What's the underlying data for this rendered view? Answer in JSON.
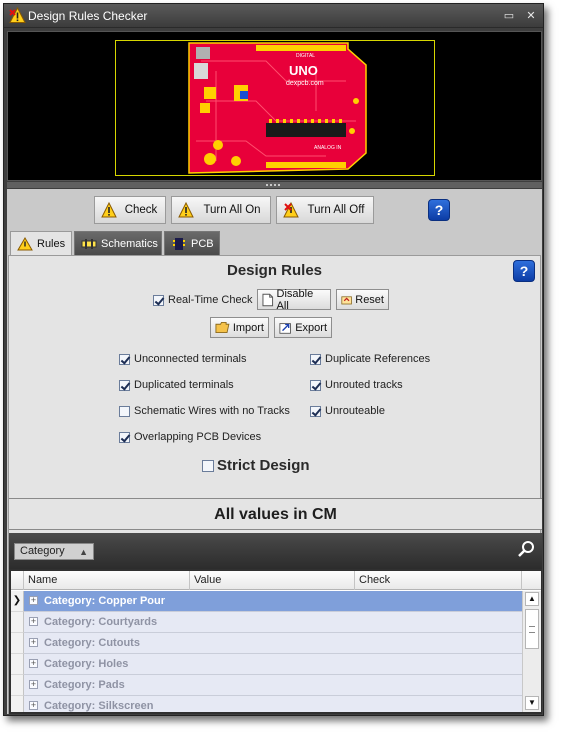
{
  "window": {
    "title": "Design Rules Checker"
  },
  "preview": {
    "board_text": "UNO",
    "board_subtext": "dexpcb.com",
    "board_digital": "DIGITAL",
    "board_analog": "ANALOG IN"
  },
  "toolbar": {
    "check_label": "Check",
    "turn_all_on_label": "Turn All On",
    "turn_all_off_label": "Turn All Off",
    "help_glyph": "?"
  },
  "tabs": [
    {
      "label": "Rules",
      "active": true
    },
    {
      "label": "Schematics",
      "active": false
    },
    {
      "label": "PCB",
      "active": false
    }
  ],
  "rules": {
    "title": "Design Rules",
    "realtime": {
      "label": "Real-Time Check",
      "checked": true
    },
    "disable_all_label": "Disable All",
    "reset_label": "Reset",
    "import_label": "Import",
    "export_label": "Export",
    "checks_left": [
      {
        "label": "Unconnected terminals",
        "checked": true
      },
      {
        "label": "Duplicated terminals",
        "checked": true
      },
      {
        "label": "Schematic Wires with no Tracks",
        "checked": false
      },
      {
        "label": "Overlapping PCB Devices",
        "checked": true
      }
    ],
    "checks_right": [
      {
        "label": "Duplicate References",
        "checked": true
      },
      {
        "label": "Unrouted tracks",
        "checked": true
      },
      {
        "label": "Unrouteable",
        "checked": true
      }
    ],
    "strict": {
      "label": "Strict Design",
      "checked": false
    }
  },
  "units_label": "All values in CM",
  "grid": {
    "group_by": "Category",
    "columns": [
      "Name",
      "Value",
      "Check"
    ],
    "rows": [
      "Category: Copper Pour",
      "Category: Courtyards",
      "Category: Cutouts",
      "Category: Holes",
      "Category: Pads",
      "Category: Silkscreen"
    ],
    "selected_row": 0
  },
  "colors": {
    "selection": "#7f9fda",
    "row_bg": "#e6e9f4",
    "row_text": "#8f93a4",
    "pcb_board": "#e8003a"
  }
}
